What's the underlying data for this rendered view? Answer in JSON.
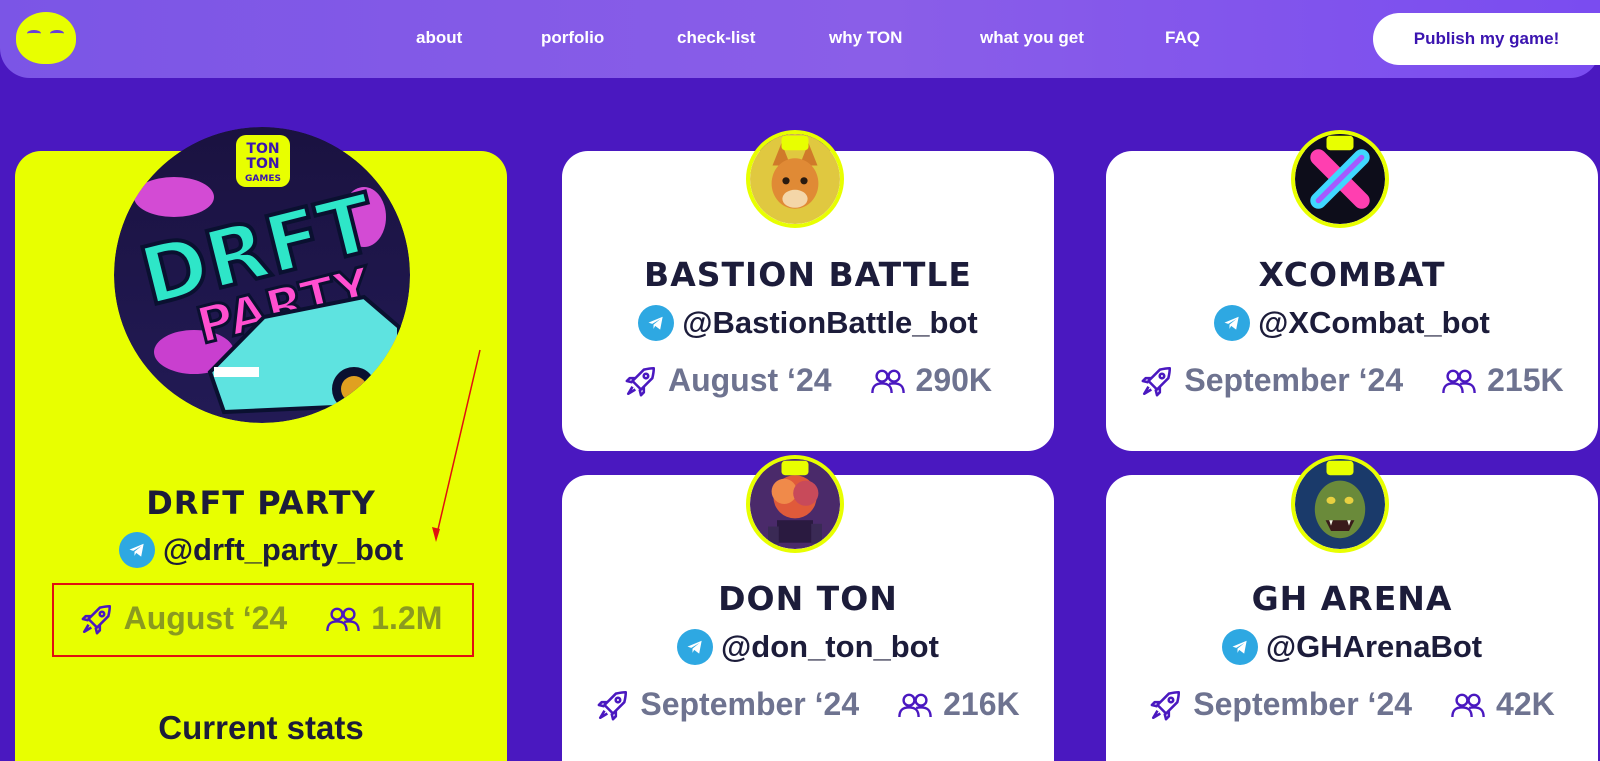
{
  "nav": {
    "links": [
      "about",
      "porfolio",
      "check-list",
      "why TON",
      "what you get",
      "FAQ"
    ],
    "publish_label": "Publish my game!"
  },
  "games": [
    {
      "title": "DRFT PARTY",
      "handle": "@drft_party_bot",
      "launch": "August ‘24",
      "users": "1.2M",
      "featured": true,
      "footer": "Current stats"
    },
    {
      "title": "BASTION BATTLE",
      "handle": "@BastionBattle_bot",
      "launch": "August ‘24",
      "users": "290K"
    },
    {
      "title": "XCOMBAT",
      "handle": "@XCombat_bot",
      "launch": "September ‘24",
      "users": "215K"
    },
    {
      "title": "DON TON",
      "handle": "@don_ton_bot",
      "launch": "September ‘24",
      "users": "216K"
    },
    {
      "title": "GH ARENA",
      "handle": "@GHArenaBot",
      "launch": "September ‘24",
      "users": "42K"
    }
  ],
  "avatar_badge": {
    "line1": "TON",
    "line2": "TON",
    "line3": "GAMES"
  },
  "featured_art": {
    "line1": "DRFT",
    "line2": "PARTY"
  },
  "colors": {
    "background": "#4a18c0",
    "accent_yellow": "#e8ff00",
    "telegram_blue": "#2ea8e2",
    "annotation_red": "#e01010"
  },
  "icons": [
    "rocket-icon",
    "users-icon",
    "telegram-icon"
  ]
}
